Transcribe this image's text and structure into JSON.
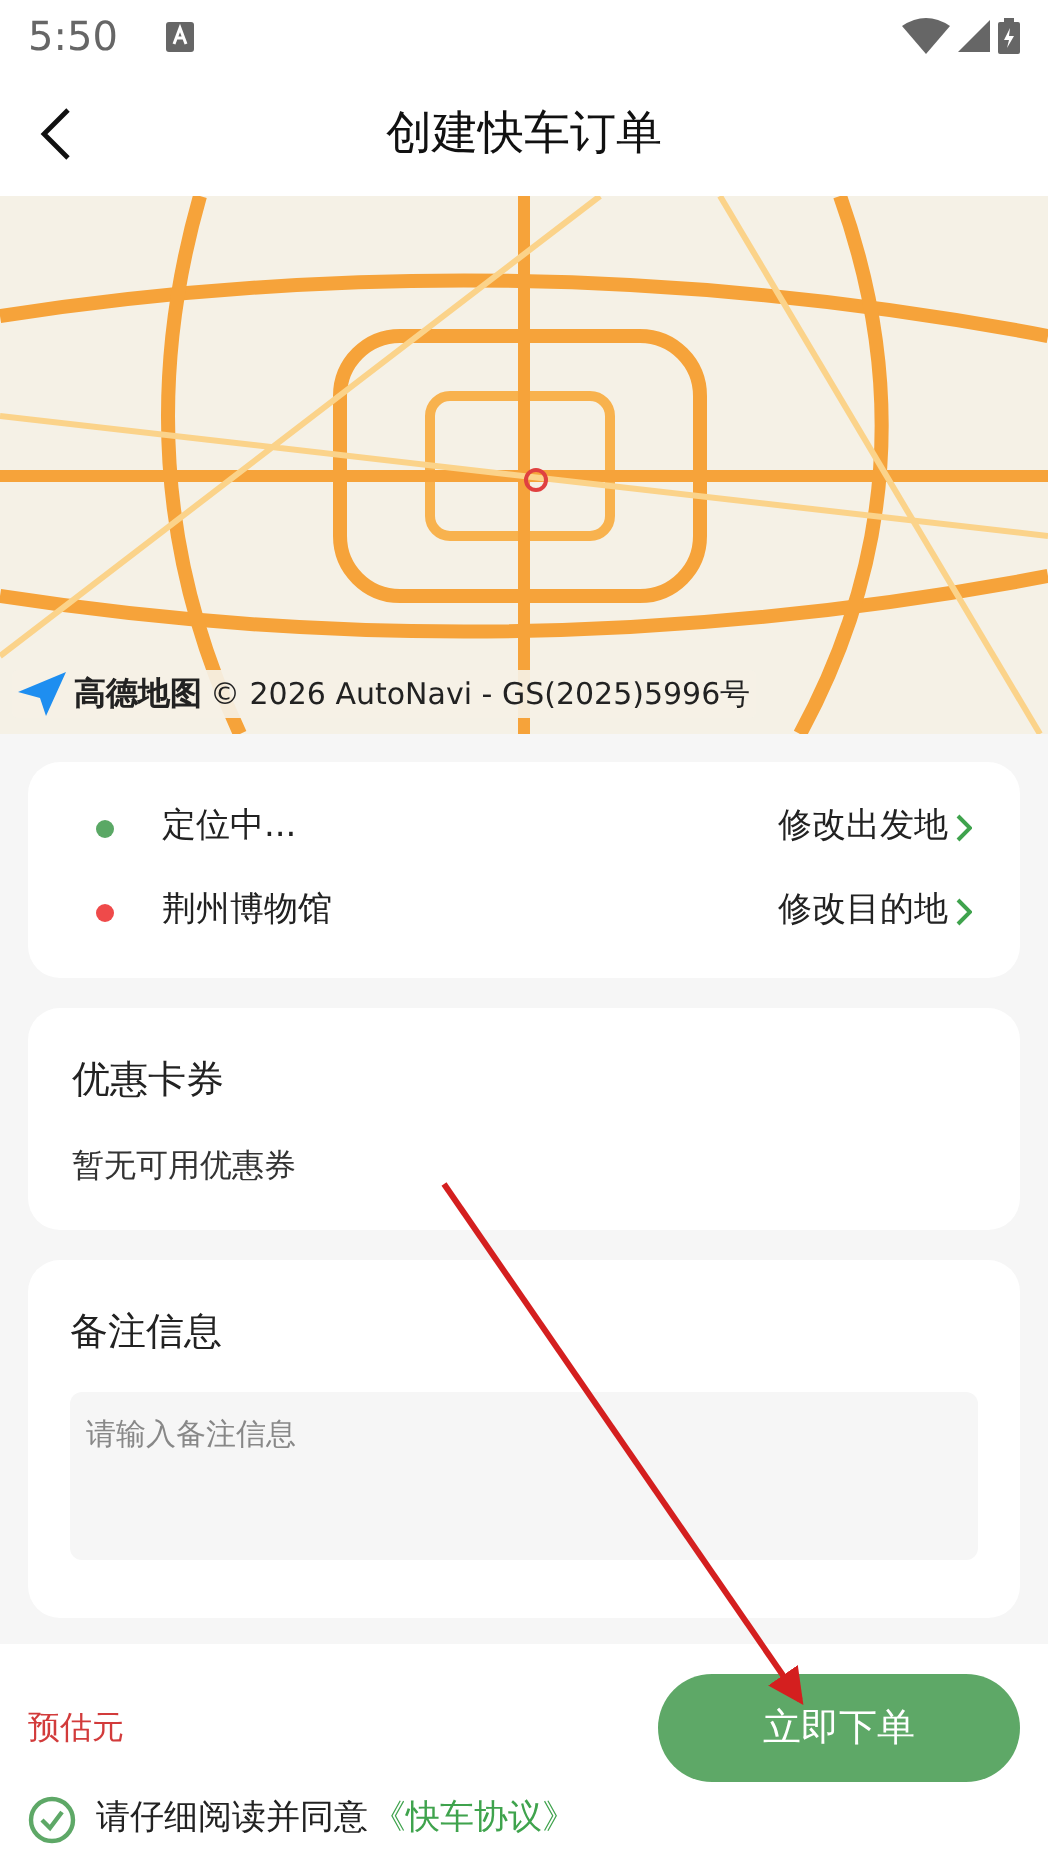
{
  "status_bar": {
    "time": "5:50"
  },
  "header": {
    "title": "创建快车订单"
  },
  "map": {
    "kind": "picture",
    "logo": "高德地图",
    "attribution": "© 2026 AutoNavi - GS(2025)5996号"
  },
  "route": [
    {
      "place": "定位中...",
      "action": "修改出发地",
      "color": "#5aa865"
    },
    {
      "place": "荆州博物馆",
      "action": "修改目的地",
      "color": "#ef4a4a"
    }
  ],
  "coupon": {
    "title": "优惠卡券",
    "note": "暂无可用优惠券"
  },
  "remark": {
    "title": "备注信息",
    "placeholder": "请输入备注信息"
  },
  "footer": {
    "estimate": "预估元",
    "submit": "立即下单",
    "agreement": {
      "checked": true,
      "text": "请仔细阅读并同意",
      "link": "《快车协议》"
    }
  }
}
